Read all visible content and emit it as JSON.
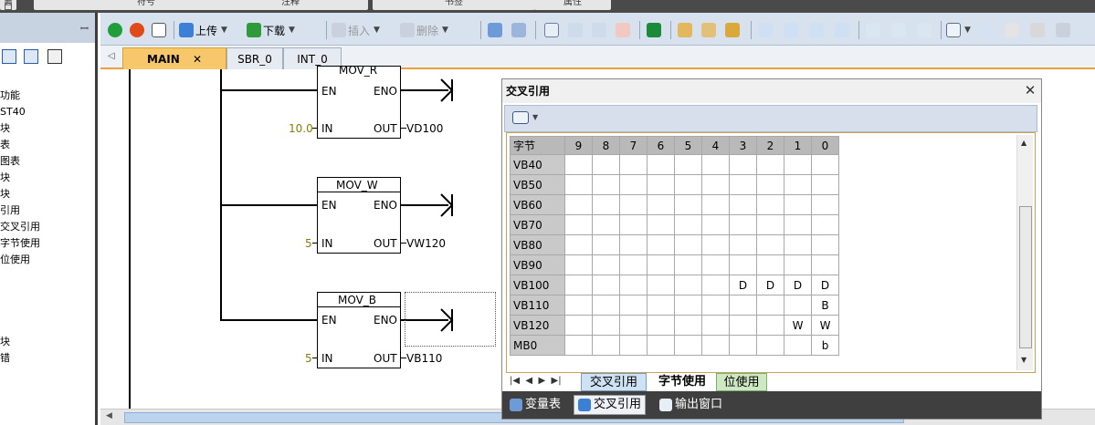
{
  "top_tabs": [
    "窗口",
    "符号",
    "注释",
    "书签",
    "属性"
  ],
  "left_panel": {
    "pin": "ꟷ",
    "tree_items": [
      "功能",
      "ST40",
      "块",
      "表",
      "图表",
      "块",
      "块",
      "引用",
      "交叉引用",
      "字节使用",
      "位使用",
      "",
      "",
      "",
      "",
      "块",
      "错"
    ]
  },
  "toolbar": {
    "upload": "上传",
    "download": "下载",
    "insert": "插入",
    "delete": "删除"
  },
  "doc_tabs": [
    {
      "label": "MAIN",
      "close": "✕",
      "active": true
    },
    {
      "label": "SBR_0",
      "active": false
    },
    {
      "label": "INT_0",
      "active": false
    }
  ],
  "ladder": {
    "block1": {
      "name": "MOV_R",
      "en": "EN",
      "eno": "ENO",
      "in_label": "IN",
      "out_label": "OUT",
      "in_value": "10.0",
      "out_value": "VD100"
    },
    "block2": {
      "name": "MOV_W",
      "en": "EN",
      "eno": "ENO",
      "in_label": "IN",
      "out_label": "OUT",
      "in_value": "5",
      "out_value": "VW120"
    },
    "block3": {
      "name": "MOV_B",
      "en": "EN",
      "eno": "ENO",
      "in_label": "IN",
      "out_label": "OUT",
      "in_value": "5",
      "out_value": "VB110"
    }
  },
  "xref": {
    "title": "交叉引用",
    "close": "✕",
    "columns": [
      "字节",
      "9",
      "8",
      "7",
      "6",
      "5",
      "4",
      "3",
      "2",
      "1",
      "0"
    ],
    "rows": [
      [
        "VB40",
        "",
        "",
        "",
        "",
        "",
        "",
        "",
        "",
        "",
        ""
      ],
      [
        "VB50",
        "",
        "",
        "",
        "",
        "",
        "",
        "",
        "",
        "",
        ""
      ],
      [
        "VB60",
        "",
        "",
        "",
        "",
        "",
        "",
        "",
        "",
        "",
        ""
      ],
      [
        "VB70",
        "",
        "",
        "",
        "",
        "",
        "",
        "",
        "",
        "",
        ""
      ],
      [
        "VB80",
        "",
        "",
        "",
        "",
        "",
        "",
        "",
        "",
        "",
        ""
      ],
      [
        "VB90",
        "",
        "",
        "",
        "",
        "",
        "",
        "",
        "",
        "",
        ""
      ],
      [
        "VB100",
        "",
        "",
        "",
        "",
        "",
        "",
        "D",
        "D",
        "D",
        "D"
      ],
      [
        "VB110",
        "",
        "",
        "",
        "",
        "",
        "",
        "",
        "",
        "",
        "B"
      ],
      [
        "VB120",
        "",
        "",
        "",
        "",
        "",
        "",
        "",
        "",
        "W",
        "W"
      ],
      [
        "MB0",
        "",
        "",
        "",
        "",
        "",
        "",
        "",
        "",
        "",
        "b"
      ]
    ],
    "sheet_nav": "|◀  ◀  ▶  ▶|",
    "sheet_tabs": [
      "交叉引用",
      "字节使用",
      "位使用"
    ],
    "active_sheet": "字节使用",
    "bottom_tabs": [
      "变量表",
      "交叉引用",
      "输出窗口"
    ]
  },
  "colors": {
    "accent": "#e8a23a",
    "tree_bg": "#c8d3e2",
    "toolbar_bg": "#d8e1ee",
    "bottom_bar": "#3f3f3f"
  }
}
